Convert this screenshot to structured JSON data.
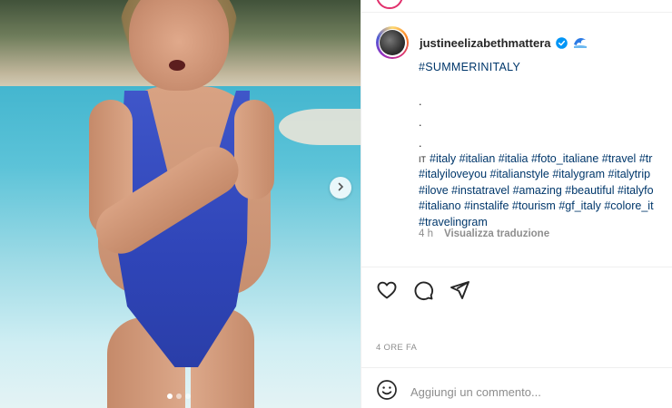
{
  "post": {
    "author": {
      "username": "justineelizabethmattera",
      "verified": true
    },
    "caption": {
      "headline": "#SUMMERINITALY",
      "dots": [
        ".",
        ".",
        "."
      ],
      "lang_prefix": "IT",
      "hashtag_lines": [
        [
          "#italy",
          "#italian",
          "#italia",
          "#foto_italiane",
          "#travel",
          "#tr"
        ],
        [
          "#italyiloveyou",
          "#italianstyle",
          "#italygram",
          "#italytrip"
        ],
        [
          "#ilove",
          "#instatravel",
          "#amazing",
          "#beautiful",
          "#italyfo"
        ],
        [
          "#italiano",
          "#instalife",
          "#tourism",
          "#gf_italy",
          "#colore_it"
        ],
        [
          "#travelingram"
        ]
      ]
    },
    "meta": {
      "age": "4 h",
      "translate_label": "Visualizza traduzione"
    },
    "timestamp": "4 ORE FA",
    "comment": {
      "placeholder": "Aggiungi un commento..."
    },
    "carousel": {
      "slide_count": 3,
      "active_index": 0
    }
  },
  "icons": {
    "next": "chevron-right-icon",
    "like": "heart-icon",
    "comment": "speech-bubble-icon",
    "share": "paper-plane-icon",
    "emoji": "smiley-icon",
    "verified": "verified-badge-icon",
    "wave": "wave-emoji-icon"
  },
  "colors": {
    "hashtag": "#00376b",
    "verified": "#0095f6",
    "muted": "#8e8e8e",
    "text": "#262626"
  }
}
